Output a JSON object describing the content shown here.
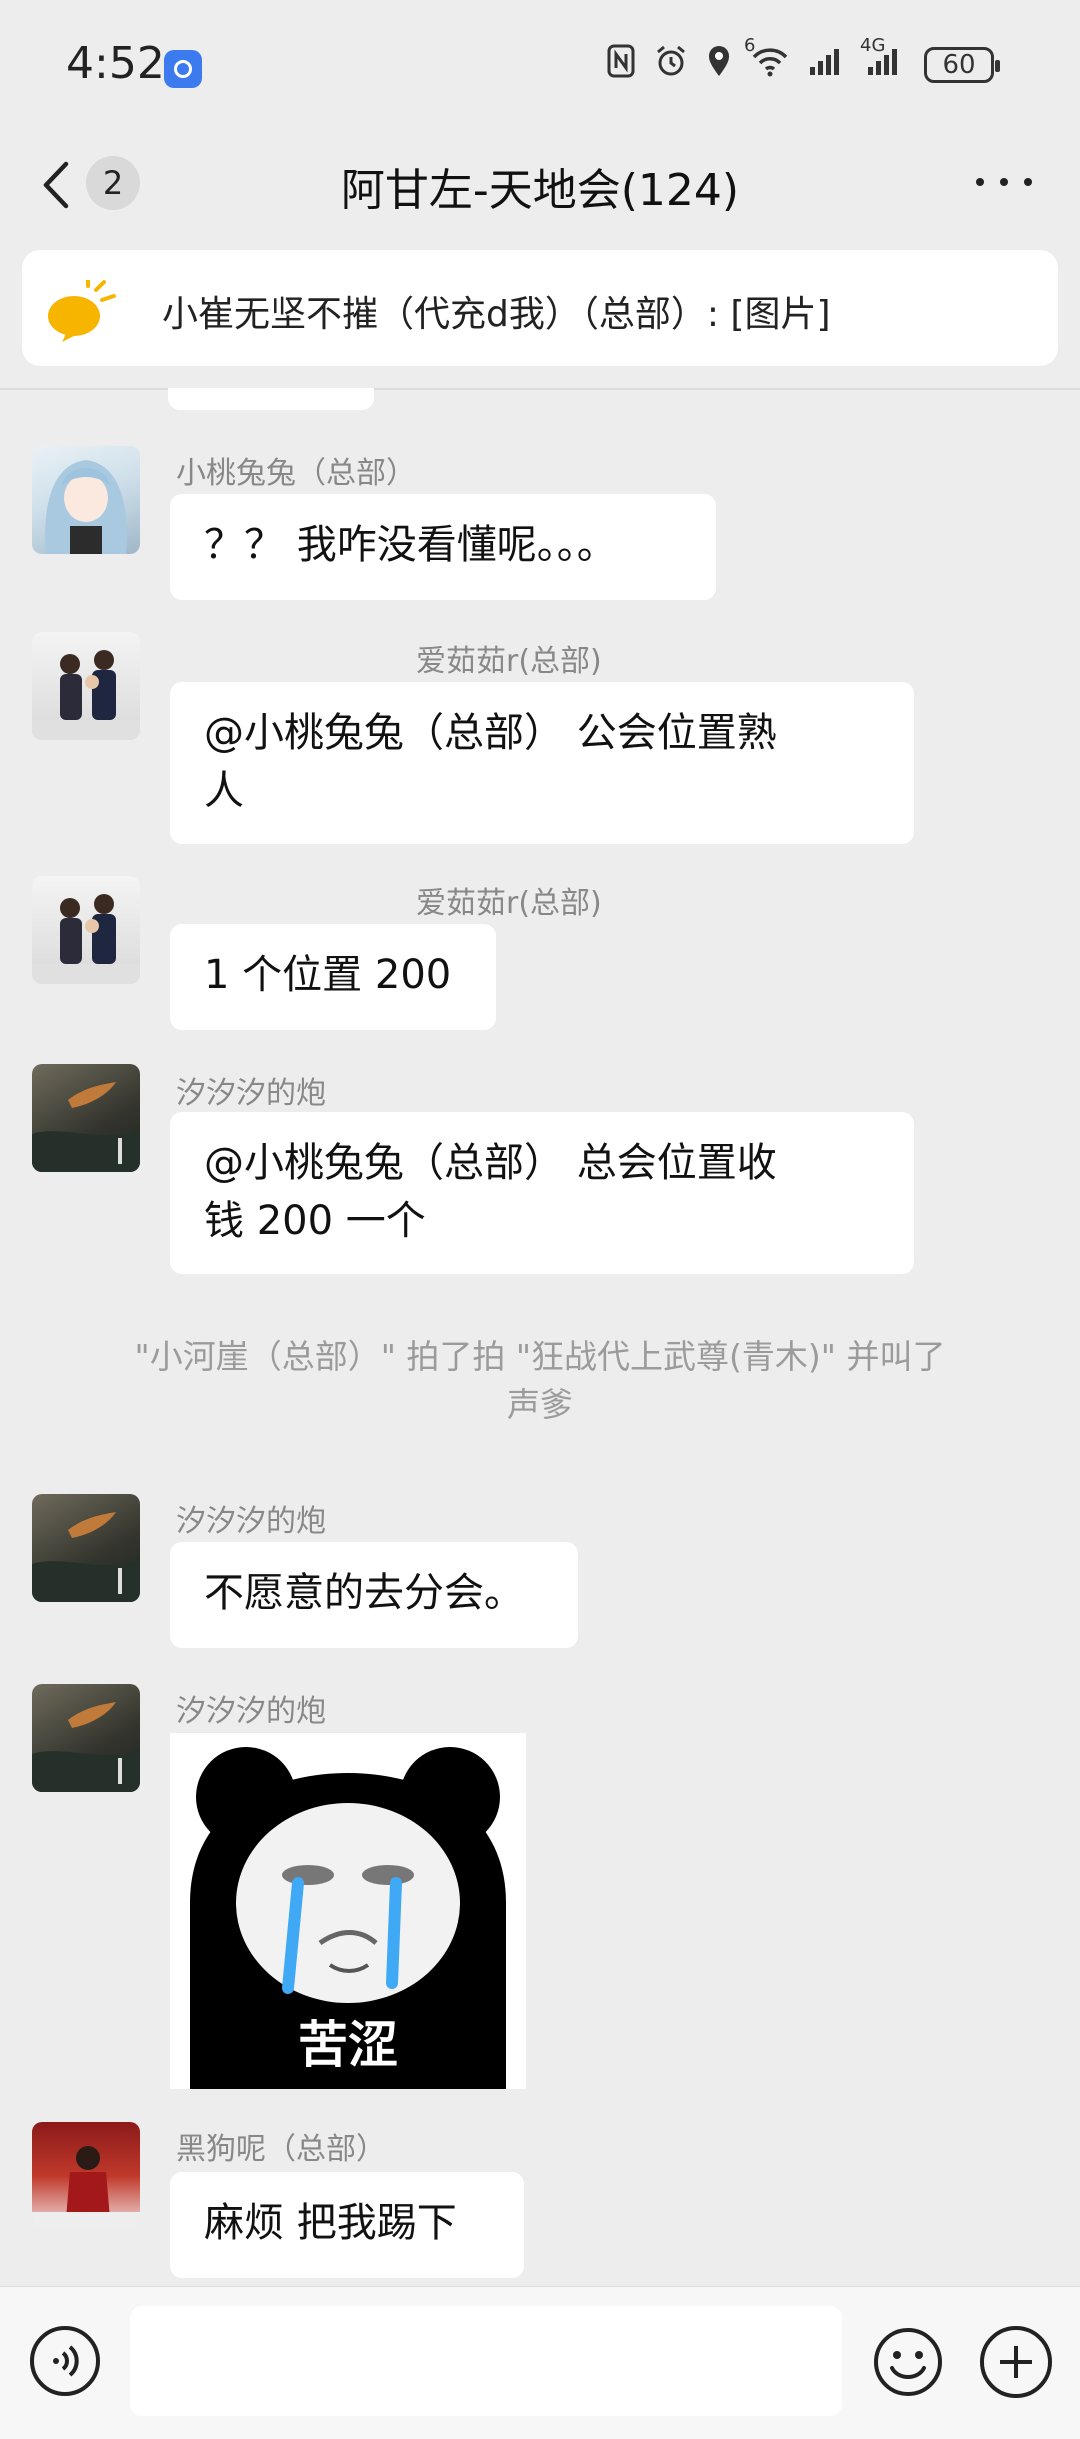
{
  "status_bar": {
    "time": "4:52",
    "signal_label": "4G",
    "wifi_label": "6",
    "battery": "60"
  },
  "header": {
    "unread_count": "2",
    "title": "阿甘左-天地会(124)"
  },
  "pinned": {
    "text": "小崔无坚不摧（代充d我）（总部）: [图片]"
  },
  "messages": [
    {
      "sender": "小桃兔兔（总部）",
      "text": "？？ 我咋没看懂呢。。。"
    },
    {
      "sender": "爱茹茹r(总部)",
      "line1": "@小桃兔兔（总部） 公会位置熟",
      "line2": "人"
    },
    {
      "sender": "爱茹茹r(总部)",
      "text": "1 个位置 200"
    },
    {
      "sender": "汐汐汐的炮",
      "line1": "@小桃兔兔（总部） 总会位置收",
      "line2": "钱 200 一个"
    },
    {
      "sender": "汐汐汐的炮",
      "text": "不愿意的去分会。"
    },
    {
      "sender": "汐汐汐的炮",
      "sticker_caption": "苦涩"
    },
    {
      "sender": "黑狗呢（总部）",
      "text": "麻烦 把我踢下"
    }
  ],
  "system_message": {
    "line1": "\"小河崖（总部）\" 拍了拍 \"狂战代上武尊(青木)\" 并叫了",
    "line2": "声爹"
  },
  "input": {
    "placeholder": ""
  },
  "icons": {
    "back": "chevron-left-icon",
    "more": "more-horizontal-icon",
    "pinned": "megaphone-icon",
    "voice": "voice-icon",
    "emoji": "emoji-icon",
    "plus": "plus-icon"
  },
  "colors": {
    "background": "#ededed",
    "bubble": "#ffffff",
    "pinned_icon": "#f7b500"
  }
}
